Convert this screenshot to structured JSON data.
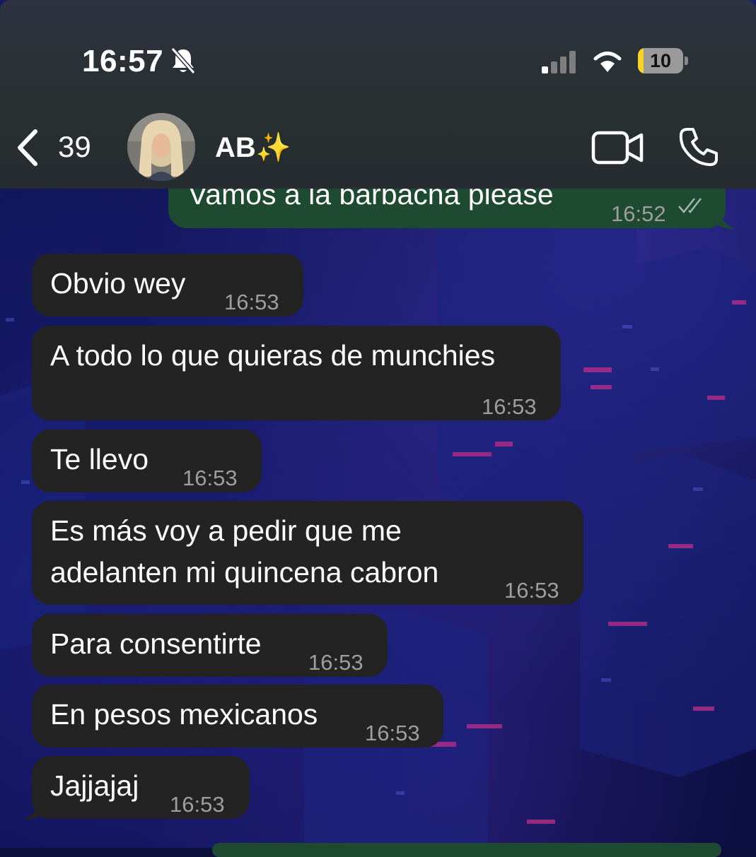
{
  "status_bar": {
    "time": "16:57",
    "battery": "10"
  },
  "header": {
    "back_count": "39",
    "contact_name": "AB✨"
  },
  "messages": [
    {
      "text": "Vamos a la barbacha please",
      "time": "16:52",
      "direction": "outgoing"
    },
    {
      "text": "Obvio wey",
      "time": "16:53",
      "direction": "incoming"
    },
    {
      "text": "A todo lo que quieras de munchies",
      "time": "16:53",
      "direction": "incoming"
    },
    {
      "text": "Te llevo",
      "time": "16:53",
      "direction": "incoming"
    },
    {
      "lines": [
        "Es más voy a pedir que me",
        "adelanten mi quincena cabron"
      ],
      "time": "16:53",
      "direction": "incoming"
    },
    {
      "text": "Para consentirte",
      "time": "16:53",
      "direction": "incoming"
    },
    {
      "text": "En pesos mexicanos",
      "time": "16:53",
      "direction": "incoming"
    },
    {
      "text": "Jajjajaj",
      "time": "16:53",
      "direction": "incoming"
    }
  ],
  "colors": {
    "incoming_bubble": "#232323",
    "outgoing_bubble": "#1e4a31",
    "wallpaper": "#0d1250"
  },
  "icons": [
    "mute-bell-icon",
    "signal-icon",
    "wifi-icon",
    "battery-icon",
    "back-chevron-icon",
    "video-call-icon",
    "phone-call-icon",
    "read-ticks-icon"
  ]
}
